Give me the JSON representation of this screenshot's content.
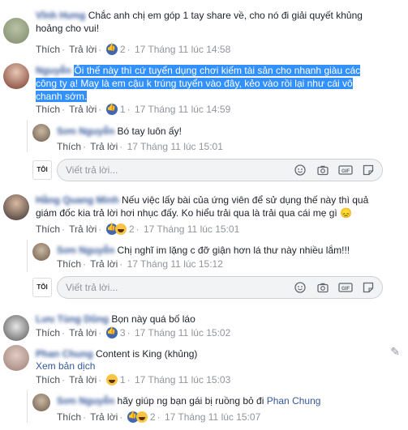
{
  "comments": [
    {
      "name": "Vĩnh Hưng",
      "text": "Chắc anh chị em góp 1 tay share về, cho nó đi giải quyết khủng hoảng cho vui!",
      "like": "Thích",
      "reply": "Trả lời",
      "count": "2",
      "time": "17 Tháng 11 lúc 14:58"
    },
    {
      "name": "Nguyễn",
      "text": "Ôi thế này thì cứ tuyển dụng chơi kiếm tài sản cho nhanh giàu các công ty ạ! May là em cậu k trúng tuyển vào đây, kẻo vào rồi lại như cái vô chanh sớm.",
      "like": "Thích",
      "reply": "Trả lời",
      "count": "1",
      "time": "17 Tháng 11 lúc 14:59"
    },
    {
      "name": "Hằng Quang Minh",
      "text": "Nếu việc lấy bài của ứng viên để sử dụng thế này thì quả giám đốc kia trả lời hơi nhục đấy. Ko hiểu trải qua là trải qua cái mẹ gì 😞",
      "like": "Thích",
      "reply": "Trả lời",
      "count": "2",
      "time": "17 Tháng 11 lúc 15:01"
    },
    {
      "name": "Lưu Tùng Dũng",
      "text": "Bọn này quá bố láo",
      "like": "Thích",
      "reply": "Trả lời",
      "count": "3",
      "time": "17 Tháng 11 lúc 15:02"
    },
    {
      "name": "Phan Chung",
      "text": "Content is King (khủng)",
      "translate": "Xem bản dịch",
      "like": "Thích",
      "reply": "Trả lời",
      "count": "1",
      "time": "17 Tháng 11 lúc 15:03"
    }
  ],
  "replies": [
    {
      "name": "Sơn Nguyễn",
      "text": "Bó tay luôn ấy!",
      "like": "Thích",
      "reply": "Trả lời",
      "time": "17 Tháng 11 lúc 15:01"
    },
    {
      "name": "Sơn Nguyễn",
      "text": "Chị nghĩ im lặng c đỡ giận hơn lá thư này nhiều lắm!!!",
      "like": "Thích",
      "reply": "Trả lời",
      "time": "17 Tháng 11 lúc 15:12"
    },
    {
      "name": "Sơn Nguyễn",
      "text": "hãy giúp ng bạn gái bị ruồng bỏ đi",
      "mention": "Phan Chung",
      "like": "Thích",
      "reply": "Trả lời",
      "count": "2",
      "time": "17 Tháng 11 lúc 15:07"
    }
  ],
  "reply_box": {
    "placeholder": "Viết trả lời...",
    "avatar_text": "TÔI"
  },
  "colors": {
    "link": "#365899",
    "highlight": "#3390ff",
    "meta": "#90949c"
  }
}
